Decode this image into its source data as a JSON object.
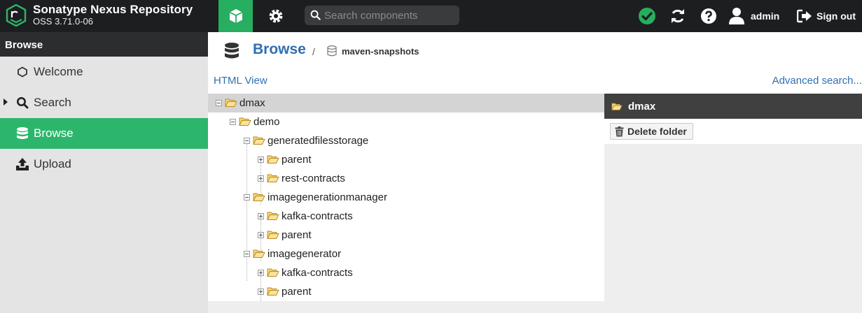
{
  "header": {
    "brand_title": "Sonatype Nexus Repository",
    "brand_version": "OSS 3.71.0-06",
    "search_placeholder": "Search components",
    "user_label": "admin",
    "signout_label": "Sign out",
    "accent": "#27ae60"
  },
  "sidebar": {
    "heading": "Browse",
    "items": [
      {
        "label": "Welcome",
        "icon": "hexagon-icon"
      },
      {
        "label": "Search",
        "icon": "search-icon"
      },
      {
        "label": "Browse",
        "icon": "database-icon",
        "active": true
      },
      {
        "label": "Upload",
        "icon": "upload-icon"
      }
    ]
  },
  "main": {
    "breadcrumb_title": "Browse",
    "breadcrumb_sep": "/",
    "repository": "maven-snapshots",
    "html_view": "HTML View",
    "advanced_search": "Advanced search...",
    "tree": [
      {
        "label": "dmax",
        "depth": 0,
        "expanded": true,
        "selected": true
      },
      {
        "label": "demo",
        "depth": 1,
        "expanded": true
      },
      {
        "label": "generatedfilesstorage",
        "depth": 2,
        "expanded": true
      },
      {
        "label": "parent",
        "depth": 3,
        "expanded": false
      },
      {
        "label": "rest-contracts",
        "depth": 3,
        "expanded": false
      },
      {
        "label": "imagegenerationmanager",
        "depth": 2,
        "expanded": true
      },
      {
        "label": "kafka-contracts",
        "depth": 3,
        "expanded": false
      },
      {
        "label": "parent",
        "depth": 3,
        "expanded": false
      },
      {
        "label": "imagegenerator",
        "depth": 2,
        "expanded": true
      },
      {
        "label": "kafka-contracts",
        "depth": 3,
        "expanded": false
      },
      {
        "label": "parent",
        "depth": 3,
        "expanded": false
      }
    ],
    "detail": {
      "title": "dmax",
      "delete_label": "Delete folder"
    }
  }
}
